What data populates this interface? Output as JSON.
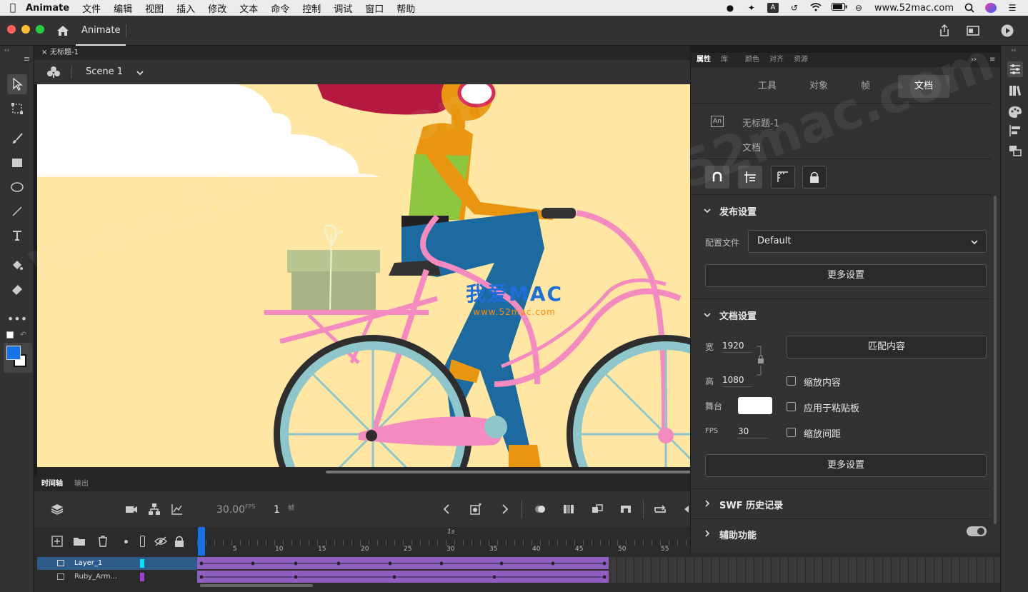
{
  "menubar": {
    "app_name": "Animate",
    "items": [
      "文件",
      "编辑",
      "视图",
      "插入",
      "修改",
      "文本",
      "命令",
      "控制",
      "调试",
      "窗口",
      "帮助"
    ],
    "site": "www.52mac.com"
  },
  "appbar": {
    "tab": "Animate"
  },
  "document": {
    "tab_title": "无标题-1",
    "scene": "Scene 1"
  },
  "stage": {
    "watermark_title": "我爱MAC",
    "watermark_url": "www.52mac.com"
  },
  "timeline": {
    "tabs": [
      "时间轴",
      "输出"
    ],
    "fps": "30.00",
    "fps_unit": "FPS",
    "frame": "1",
    "frame_unit": "帧",
    "ruler_second": "1s",
    "ruler_ticks": [
      "5",
      "10",
      "15",
      "20",
      "25",
      "30",
      "35",
      "40",
      "45",
      "50",
      "55"
    ],
    "layers": [
      {
        "name": "Layer_1",
        "color": "#00e5ff"
      },
      {
        "name": "Ruby_Arm...",
        "color": "#a040d0"
      }
    ]
  },
  "properties": {
    "panel_tabs": [
      "属性",
      "库",
      "颜色",
      "对齐",
      "资源"
    ],
    "sub_tabs": [
      "工具",
      "对象",
      "帧",
      "文档"
    ],
    "active_sub_tab": "文档",
    "doc_icon": "An",
    "doc_name": "无标题-1",
    "doc_type": "文档",
    "publish": {
      "title": "发布设置",
      "profile_label": "配置文件",
      "profile_value": "Default",
      "more": "更多设置"
    },
    "doc_settings": {
      "title": "文档设置",
      "width_label": "宽",
      "width": "1920",
      "height_label": "高",
      "height": "1080",
      "match_button": "匹配内容",
      "scale_content": "缩放内容",
      "apply_pasteboard": "应用于粘贴板",
      "scale_spacing": "缩放间距",
      "stage_label": "舞台",
      "stage_color": "#ffffff",
      "fps_label": "FPS",
      "fps": "30",
      "more": "更多设置"
    },
    "swf_history": "SWF 历史记录",
    "accessibility": "辅助功能"
  },
  "colors": {
    "accent": "#1473e6",
    "frames_purple": "#8e5fc0",
    "stage_bg": "#ffe6a3"
  }
}
